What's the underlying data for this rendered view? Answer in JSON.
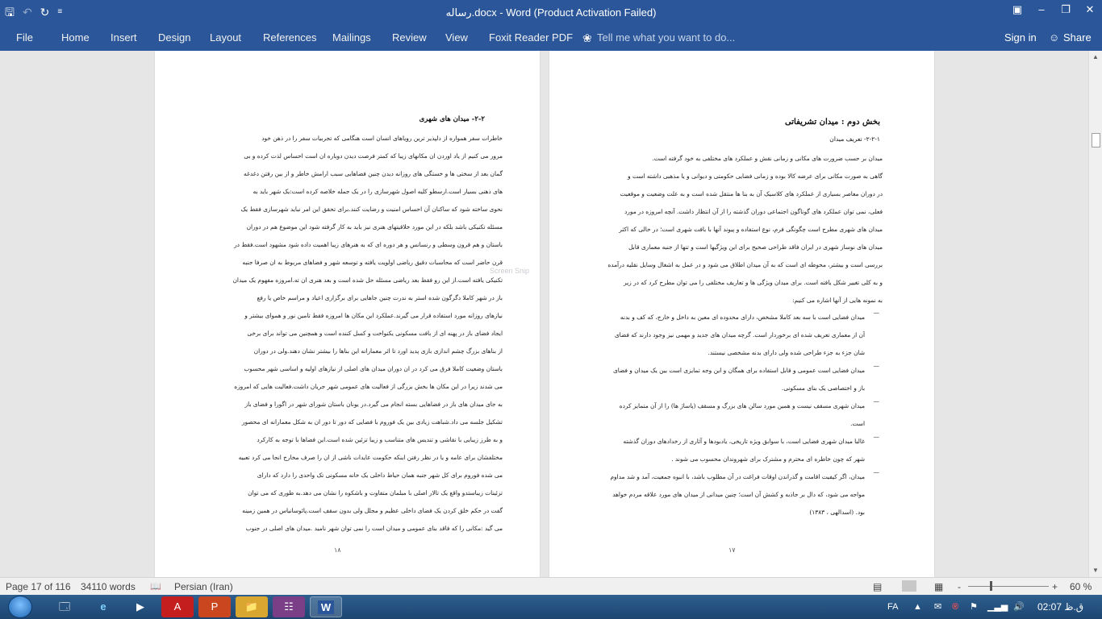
{
  "titlebar": {
    "title": "رساله.docx - Word (Product Activation Failed)",
    "qat_save_icon": "save-icon",
    "qat_undo_icon": "undo-icon",
    "qat_redo_icon": "redo-icon"
  },
  "ribbon": {
    "tabs": [
      "File",
      "Home",
      "Insert",
      "Design",
      "Layout",
      "References",
      "Mailings",
      "Review",
      "View",
      "Foxit Reader PDF"
    ],
    "tell_me": "Tell me what you want to do...",
    "sign_in": "Sign in",
    "share": "Share"
  },
  "left_page": {
    "heading": "۲-۲- میدان های شهری",
    "lines": [
      "خاطرات سفر همواره از دلپذیر ترین رویاهای انسان است هنگامی که تجربیات سفر را در ذهن خود",
      "مرور می کنیم از یاد اوردن ان مکانهای زیبا که کمتر فرصت دیدن دوباره ان است احساس لذت کرده و بی",
      "گمان بعد از سختی ها و خستگی های روزانه دیدن چنین فضاهایی سبب ارامش خاطر و از بین رفتن دغدغه",
      "های ذهنی بسیار است.ارسطو کلیه اصول شهرسازی را در یک جمله خلاصه کرده است:یک شهر باید به",
      "نحوی ساخته شود که ساکنان آن احساس امنیت و رضایت کنند.برای تحقق این امر نباید شهرسازی فقط یک",
      "مسئله تکنیکی باشد بلکه در این مورد خلاقیتهای هنری نیز باید به کار گرفته شود این موضوع هم در دوران",
      "باستان و هم قرون وسطی و رنسانس و هر دوره ای که به هنرهای زیبا اهمیت داده شود مشهود است.فقط در",
      "قرن حاضر است که محاسبات دقیق ریاضی اولویت یافته و توسعه شهر و فضاهای مربوط به ان صرفا جنبه",
      "تکنیکی یافته است.از این رو فقط بعد ریاضی مسئله حل شده است و بعد هنری ان ته.امروزه مفهوم یک میدان",
      "باز در شهر کاملا دگرگون شده استر به ندرت چنین جاهایی برای برگزاری اعیاد و مراسم خاص یا رفع",
      "نیازهای روزانه مورد استفاده قرار می گیرند.عملکرد این مکان ها امروزه فقط تامین نور و هموای بیشتر و",
      "ایجاد فضای باز در پهنه ای از بافت مسکونی یکنواخت و کسل کننده است و همچنین می تواند برای برخی",
      "از بناهای بزرگ چشم اندازی بازی پدید اورد تا اثر معمارانه این بناها را بیشتر نشان دهند.ولی در دوران",
      "باستان وضعیت کاملا فرق می کرد در ان دوران میدان های اصلی از نیازهای اولیه و اساسی شهر محسوب",
      "می شدند زیرا در این مکان ها بخش بزرگی از فعالیت های عمومی شهر جریان داشت.فعالیت هایی که امروزه",
      "به جای میدان های باز در فضاهایی بسته انجام می گیرد.در یونان باستان شورای شهر در اگورا و فضای باز",
      "تشکیل جلسه می داد.شباهت زیادی بین یک فوروم با فضایی که دور تا دور ان به شکل معمارانه ای محصور",
      "و به طرز زیبایی با نقاشی و تندیس های متناسب و زیبا تزئین شده است.این فضاها با توجه به کارکرد",
      "مختلفشان برای عامه و یا در نظر رفتن اینکه حکومت عایدات ناشی از ان را صرف مخارج انجا می کرد تعبیه",
      "می شده فوروم برای کل شهر جنبه همان حیاط داخلی یک خانه مسکونی تک واحدی را دارد که دارای",
      "تزئینات زیباستدو واقع یک تالار اصلی با مبلمان متفاوت و باشکوه را نشان می دهد.به طوری که می توان",
      "گفت در حکم خلق کردن یک فضای داخلی عظیم و مجلل ولی بدون سقف است.پائوسانیاس در همین زمینه",
      "می گید :مکانی را که فاقد بنای عمومی و میدان است را نمی توان شهر نامید .میدان های اصلی در جنوب"
    ],
    "page_number": "۱۸"
  },
  "right_page": {
    "section_title": "بخش دوم : میدان تشریفاتی",
    "subheading": "۲-۲-۱- تعریف میدان",
    "paragraph_lines": [
      "میدان بر حسب ضرورت های مکانی و زمانی نقش و عملکرد های مختلفی به خود گرفته است.",
      "گاهی به صورت مکانی برای عرضه کالا بوده و زمانی فضایی حکومتی و دیوانی و یا مذهبی داشته است و",
      "در دوران معاصر بسیاری از عملکرد های کلاسیک آن به بنا ها منتقل شده است و به علت وضعیت و موقعیت",
      "فعلی، نمی توان عملکرد های گوناگون اجتماعی دوران گذشته را از آن انتظار داشت. آنچه امروزه در مورد",
      "میدان های شهری مطرح است چگونگی فرم، نوع استفاده و پیوند آنها با بافت شهری است؛ در حالی که اکثر",
      "میدان های نوساز شهری در ایران فاقد طراحی صحیح برای این ویژگیها است و تنها از جنبه معماری قابل",
      "بررسی است و بیشتر، محوطه ای است که به آن میدان اطلاق می شود و در عمل به اشغال وسایل نقلیه درآمده",
      "و به کلی تغییر شکل یافته است. برای میدان ویژگی ها و تعاریف مختلفی را می توان مطرح کرد که در زیر",
      "به نمونه هایی از آنها اشاره می کنیم:"
    ],
    "bullets": [
      [
        "میدان فضایی است با سه بعد کاملا مشخص، دارای محدوده ای معین به داخل و خارج، که کف و بدنه",
        "آن از معماری تعریف شده ای برخوردار است. گرچه میدان های جدید و مهمی نیز وجود دارند که فضای",
        "شان جزء به جزء طراحی شده ولی دارای بدنه مشخصی نیستند."
      ],
      [
        "میدان فضایی است عمومی و قابل استفاده برای همگان و این وجه تمایزی است بین یک میدان و فضای",
        "باز و اختصاصی یک بنای مسکونی."
      ],
      [
        "میدان شهری مسقف نیست و همین مورد سالن های بزرگ و مسقف (پاساژ ها) را از آن متمایز کرده",
        "است."
      ],
      [
        "غالبا میدان شهری فضایی است، با سوابق ویژه تاریخی، یادبودها و آثاری از رخدادهای دوران گذشته",
        "شهر که چون خاطره ای محترم و مشترک برای شهروندان محسوب می شوند ."
      ],
      [
        "میدان، اگر کیفیت اقامت و گذراندن اوقات فراغت در آن مطلوب باشد، با انبوه جمعیت، آمد و شد مداوم",
        "مواجه می شود، که دال بر جاذبه و کشش آن است؛ چنین میدانی از میدان های مورد علاقه مردم خواهد",
        "بود. (اسدالهی ، ۱۳۸۳)"
      ]
    ],
    "page_number": "۱۷"
  },
  "watermark": "Screen Snip",
  "statusbar": {
    "page": "Page 17 of 116",
    "words": "34110 words",
    "language": "Persian (Iran)",
    "zoom": "60 %",
    "zoom_minus": "-",
    "zoom_plus": "+"
  },
  "taskbar": {
    "language": "FA",
    "clock": "02:07 ق.ظ",
    "apps": [
      "explorer-icon",
      "ie-icon",
      "play-icon",
      "acrobat-icon",
      "powerpoint-icon",
      "folder-icon",
      "winrar-icon",
      "word-icon"
    ]
  }
}
